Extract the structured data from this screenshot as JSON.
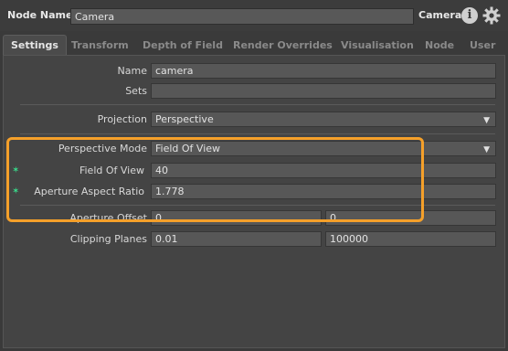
{
  "header": {
    "node_name_label": "Node Name",
    "node_name_value": "Camera",
    "node_type": "Camera",
    "info_icon": "info-icon",
    "settings_icon": "gear-icon"
  },
  "tabs": [
    {
      "label": "Settings",
      "active": true
    },
    {
      "label": "Transform"
    },
    {
      "label": "Depth of Field"
    },
    {
      "label": "Render Overrides"
    },
    {
      "label": "Visualisation"
    },
    {
      "label": "Node"
    },
    {
      "label": "User"
    }
  ],
  "settings": {
    "name": {
      "label": "Name",
      "value": "camera"
    },
    "sets": {
      "label": "Sets",
      "value": ""
    },
    "projection": {
      "label": "Projection",
      "value": "Perspective"
    },
    "perspective_mode": {
      "label": "Perspective Mode",
      "value": "Field Of View"
    },
    "field_of_view": {
      "label": "Field Of View",
      "value": "40"
    },
    "aperture_aspect_ratio": {
      "label": "Aperture Aspect Ratio",
      "value": "1.778"
    },
    "aperture_offset": {
      "label": "Aperture Offset",
      "x": "0",
      "y": "0"
    },
    "clipping_planes": {
      "label": "Clipping Planes",
      "near": "0.01",
      "far": "100000"
    }
  },
  "colors": {
    "highlight": "#f5a02a",
    "star": "#39d98a"
  }
}
